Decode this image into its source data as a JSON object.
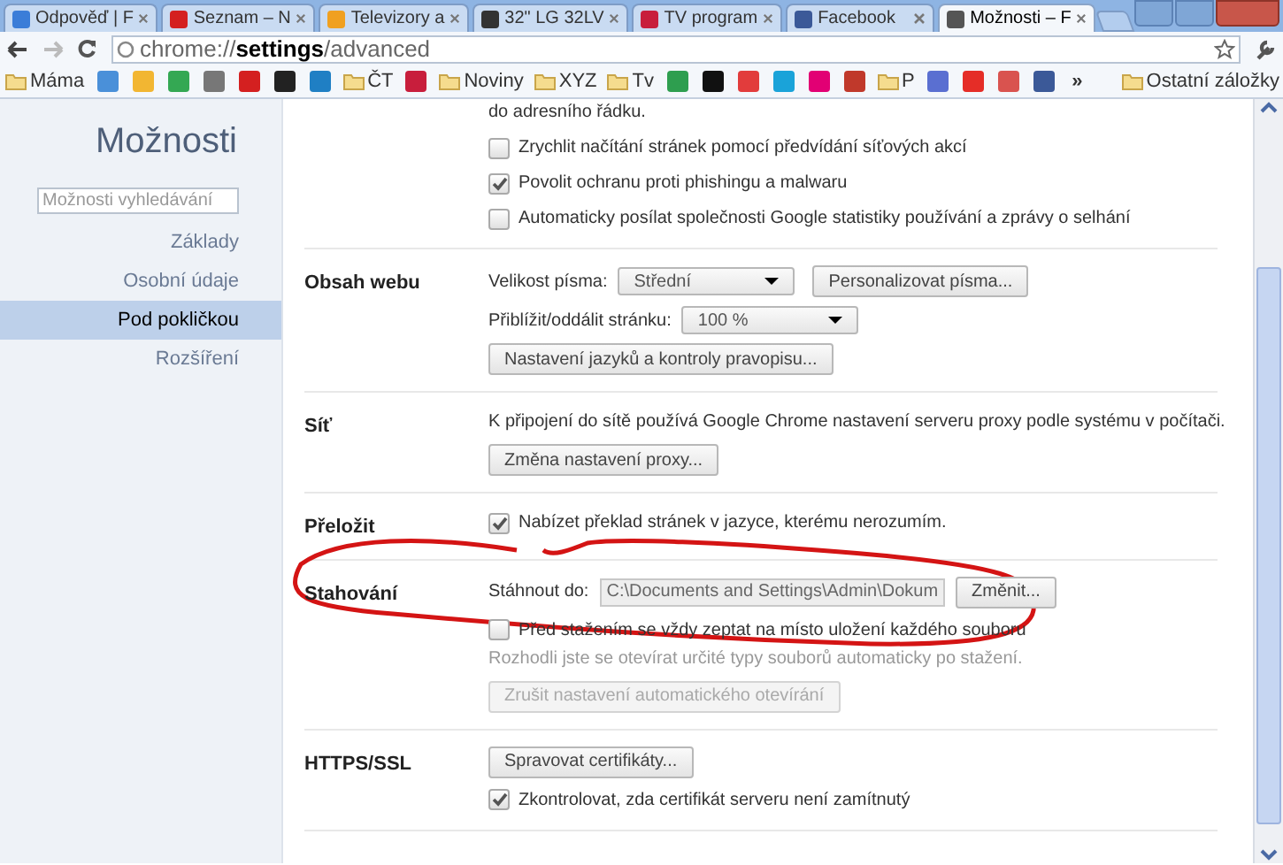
{
  "tabs": [
    {
      "label": "Odpověď | F",
      "color": "#3b7dd8",
      "selected": false
    },
    {
      "label": "Seznam – N",
      "color": "#d42020",
      "selected": false
    },
    {
      "label": "Televizory a",
      "color": "#f0a020",
      "selected": false
    },
    {
      "label": "32\" LG 32LV",
      "color": "#333333",
      "selected": false
    },
    {
      "label": "TV program",
      "color": "#c81e3c",
      "selected": false
    },
    {
      "label": "Facebook",
      "color": "#3b5998",
      "selected": false
    },
    {
      "label": "Možnosti – F",
      "color": "#555555",
      "selected": true
    }
  ],
  "address": {
    "prefix": "chrome://",
    "host": "settings",
    "path": "/advanced"
  },
  "bookmarks": [
    {
      "kind": "folder",
      "label": "Máma"
    },
    {
      "kind": "site",
      "color": "#4a90d9"
    },
    {
      "kind": "site",
      "color": "#f2b632"
    },
    {
      "kind": "site",
      "color": "#34a853"
    },
    {
      "kind": "site",
      "color": "#777777"
    },
    {
      "kind": "site",
      "color": "#d42020"
    },
    {
      "kind": "site",
      "color": "#222222"
    },
    {
      "kind": "site",
      "color": "#1f7fc4"
    },
    {
      "kind": "folder",
      "label": "ČT"
    },
    {
      "kind": "site",
      "color": "#c81e3c"
    },
    {
      "kind": "folder",
      "label": "Noviny"
    },
    {
      "kind": "folder",
      "label": "XYZ"
    },
    {
      "kind": "folder",
      "label": "Tv"
    },
    {
      "kind": "site",
      "color": "#2e9e4f"
    },
    {
      "kind": "site",
      "color": "#111111"
    },
    {
      "kind": "site",
      "color": "#e23c3c"
    },
    {
      "kind": "site",
      "color": "#1aa3d9"
    },
    {
      "kind": "site",
      "color": "#e20074"
    },
    {
      "kind": "site",
      "color": "#c0392b"
    },
    {
      "kind": "folder",
      "label": "P"
    },
    {
      "kind": "site",
      "color": "#5a6fd1"
    },
    {
      "kind": "site",
      "color": "#e52d27"
    },
    {
      "kind": "site",
      "color": "#d9534f"
    },
    {
      "kind": "site",
      "color": "#3b5998"
    }
  ],
  "bookmarks_more": "»",
  "other_bookmarks": "Ostatní záložky",
  "sidebar": {
    "title": "Možnosti",
    "search_placeholder": "Možnosti vyhledávání",
    "items": [
      {
        "label": "Základy",
        "selected": false
      },
      {
        "label": "Osobní údaje",
        "selected": false
      },
      {
        "label": "Pod pokličkou",
        "selected": true
      },
      {
        "label": "Rozšíření",
        "selected": false
      }
    ]
  },
  "sections": [
    {
      "rows": [
        {
          "kind": "text",
          "text": "do adresního řádku."
        },
        {
          "kind": "checkbox",
          "label": "Zrychlit načítání stránek pomocí předvídání síťových akcí",
          "checked": false
        },
        {
          "kind": "checkbox",
          "label": "Povolit ochranu proti phishingu a malwaru",
          "checked": true
        },
        {
          "kind": "checkbox",
          "label": "Automaticky posílat společnosti Google statistiky používání a zprávy o selhání",
          "checked": false
        }
      ]
    },
    {
      "heading": "Obsah webu",
      "rows": [
        {
          "kind": "select",
          "label": "Velikost písma:",
          "value": "Střední",
          "button": "Personalizovat písma..."
        },
        {
          "kind": "select",
          "label": "Přiblížit/oddálit stránku:",
          "value": "100 %"
        },
        {
          "kind": "button",
          "label": "Nastavení jazyků a kontroly pravopisu..."
        }
      ]
    },
    {
      "heading": "Síť",
      "rows": [
        {
          "kind": "text",
          "text": "K připojení do sítě používá Google Chrome nastavení serveru proxy podle systému v počítači."
        },
        {
          "kind": "button",
          "label": "Změna nastavení proxy..."
        }
      ]
    },
    {
      "heading": "Přeložit",
      "rows": [
        {
          "kind": "checkbox",
          "label": "Nabízet překlad stránek v jazyce, kterému nerozumím.",
          "checked": true
        }
      ]
    },
    {
      "heading": "Stahování",
      "annotated": true,
      "rows": [
        {
          "kind": "path",
          "label": "Stáhnout do:",
          "value": "C:\\Documents and Settings\\Admin\\Dokum",
          "button": "Změnit..."
        },
        {
          "kind": "checkbox",
          "label": "Před stažením se vždy zeptat na místo uložení každého souboru",
          "checked": false
        },
        {
          "kind": "hint",
          "text": "Rozhodli jste se otevírat určité typy souborů automaticky po stažení."
        },
        {
          "kind": "button",
          "label": "Zrušit nastavení automatického otevírání",
          "disabled": true
        }
      ]
    },
    {
      "heading": "HTTPS/SSL",
      "rows": [
        {
          "kind": "button",
          "label": "Spravovat certifikáty..."
        },
        {
          "kind": "checkbox",
          "label": "Zkontrolovat, zda certifikát serveru není zamítnutý",
          "checked": true
        }
      ]
    }
  ]
}
